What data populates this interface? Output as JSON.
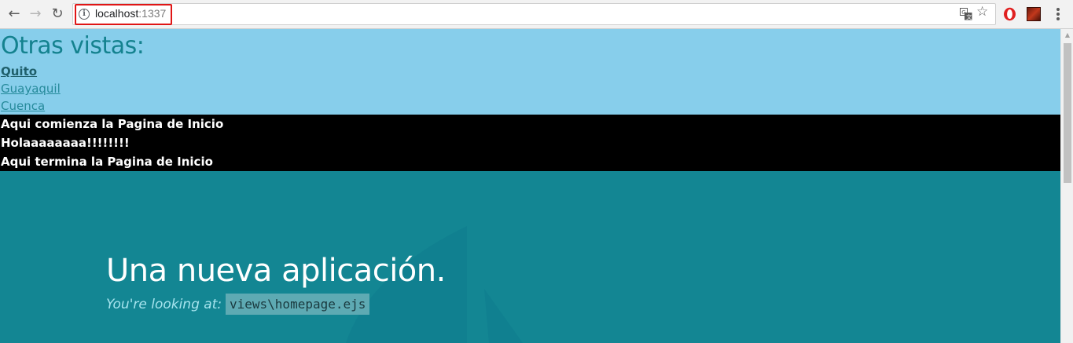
{
  "browser": {
    "url_host": "localhost",
    "url_port": ":1337",
    "icons": {
      "back": "back-arrow-icon",
      "forward": "forward-arrow-icon",
      "reload": "reload-icon",
      "info": "info-icon",
      "translate": "translate-icon",
      "bookmark": "star-icon",
      "opera_extension": "opera-extension-icon",
      "game_extension": "game-extension-icon",
      "menu": "menu-icon"
    },
    "highlight_color": "#e01515"
  },
  "nav": {
    "heading": "Otras vistas:",
    "links": [
      {
        "label": "Quito"
      },
      {
        "label": "Guayaquil"
      },
      {
        "label": "Cuenca"
      }
    ],
    "background": "#87ceeb",
    "heading_color": "#14828f"
  },
  "home": {
    "lines": [
      "Aqui comienza la Pagina de Inicio",
      "Holaaaaaaaa!!!!!!!!",
      "Aqui termina la Pagina de Inicio"
    ],
    "background": "#000000"
  },
  "hero": {
    "title": "Una nueva aplicación.",
    "subtitle": "You're looking at:",
    "code": "views\\homepage.ejs",
    "background": "#138693"
  }
}
